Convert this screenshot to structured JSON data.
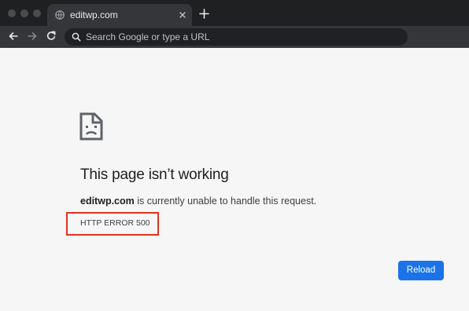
{
  "browser": {
    "tab": {
      "title": "editwp.com",
      "favicon": "globe-icon"
    },
    "omnibox": {
      "placeholder": "Search Google or type a URL"
    }
  },
  "error_page": {
    "icon": "sad-page-icon",
    "title": "This page isn’t working",
    "description_domain": "editwp.com",
    "description_rest": " is currently unable to handle this request.",
    "error_code": "HTTP ERROR 500",
    "reload_label": "Reload"
  },
  "colors": {
    "highlight_box": "#e5311f",
    "reload_button": "#1a73e8"
  }
}
